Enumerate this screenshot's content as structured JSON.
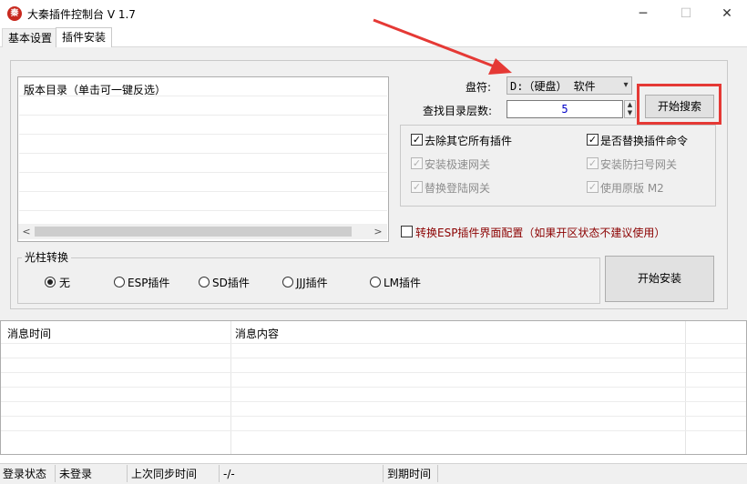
{
  "window": {
    "title": "大秦插件控制台 V 1.7",
    "icon_text": "秦",
    "minimize": "─",
    "maximize": "☐",
    "close": "✕"
  },
  "tabs": [
    {
      "label": "基本设置",
      "active": false
    },
    {
      "label": "插件安装",
      "active": true
    }
  ],
  "version_list": {
    "header": "版本目录（单击可一键反选）",
    "scroll_left": "<",
    "scroll_right": ">"
  },
  "drive": {
    "label": "盘符:",
    "value": "D:（硬盘） 软件"
  },
  "depth": {
    "label": "查找目录层数:",
    "value": "5"
  },
  "search_button": "开始搜索",
  "options": [
    {
      "label": "去除其它所有插件",
      "checked": true,
      "enabled": true
    },
    {
      "label": "是否替换插件命令",
      "checked": true,
      "enabled": true
    },
    {
      "label": "安装极速网关",
      "checked": true,
      "enabled": false
    },
    {
      "label": "安装防扫号网关",
      "checked": true,
      "enabled": false
    },
    {
      "label": "替换登陆网关",
      "checked": true,
      "enabled": false
    },
    {
      "label": "使用原版 M2",
      "checked": true,
      "enabled": false
    }
  ],
  "esp_option": {
    "label": "转换ESP插件界面配置（如果开区状态不建议使用）",
    "checked": false
  },
  "pillar": {
    "title": "光柱转换",
    "options": [
      {
        "label": "无",
        "selected": true
      },
      {
        "label": "ESP插件",
        "selected": false
      },
      {
        "label": "SD插件",
        "selected": false
      },
      {
        "label": "JJJ插件",
        "selected": false
      },
      {
        "label": "LM插件",
        "selected": false
      }
    ]
  },
  "install_button": "开始安装",
  "log_table": {
    "columns": [
      "消息时间",
      "消息内容"
    ]
  },
  "status_bar": {
    "login_label": "登录状态",
    "login_value": "未登录",
    "sync_label": "上次同步时间",
    "sync_value": "-/-",
    "expire_label": "到期时间",
    "expire_value": ""
  },
  "colors": {
    "highlight_box": "#e53935",
    "esp_text": "#8b0000",
    "depth_value": "#0000c8"
  }
}
